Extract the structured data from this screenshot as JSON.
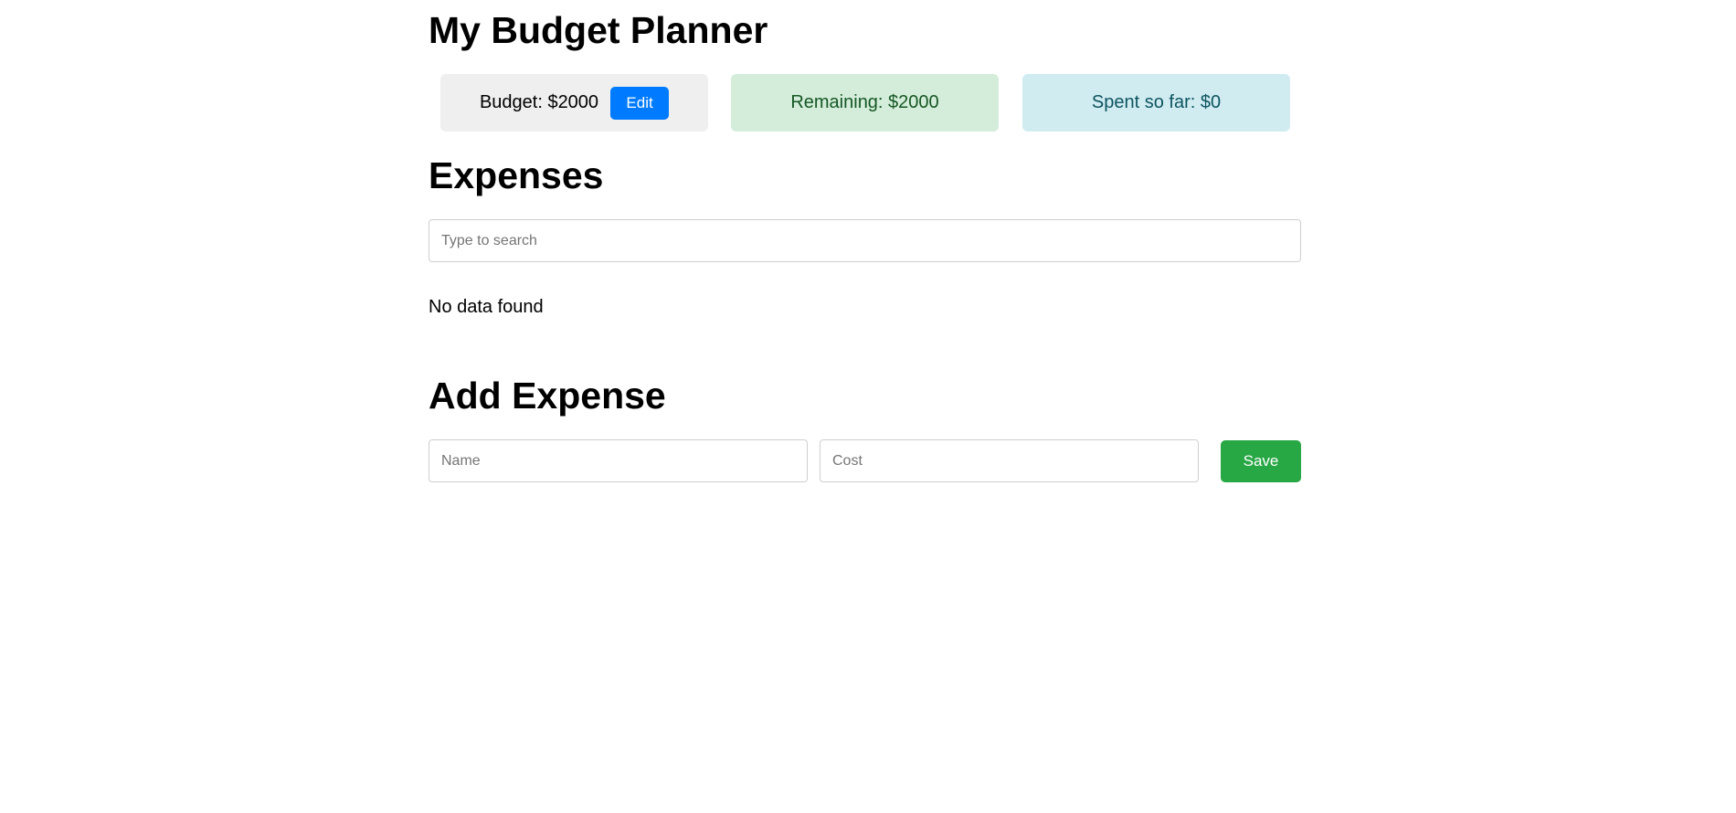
{
  "app": {
    "title": "My Budget Planner"
  },
  "summary": {
    "budget_text": "Budget: $2000",
    "edit_label": "Edit",
    "remaining_text": "Remaining: $2000",
    "spent_text": "Spent so far: $0"
  },
  "expenses": {
    "heading": "Expenses",
    "search_placeholder": "Type to search",
    "search_value": "",
    "empty_message": "No data found"
  },
  "add_expense": {
    "heading": "Add Expense",
    "name_placeholder": "Name",
    "name_value": "",
    "cost_placeholder": "Cost",
    "cost_value": "",
    "save_label": "Save"
  },
  "colors": {
    "edit_button": "#007bff",
    "save_button": "#28a745",
    "budget_card": "#efefef",
    "remaining_card": "#d4edda",
    "spent_card": "#d1ecf1"
  }
}
